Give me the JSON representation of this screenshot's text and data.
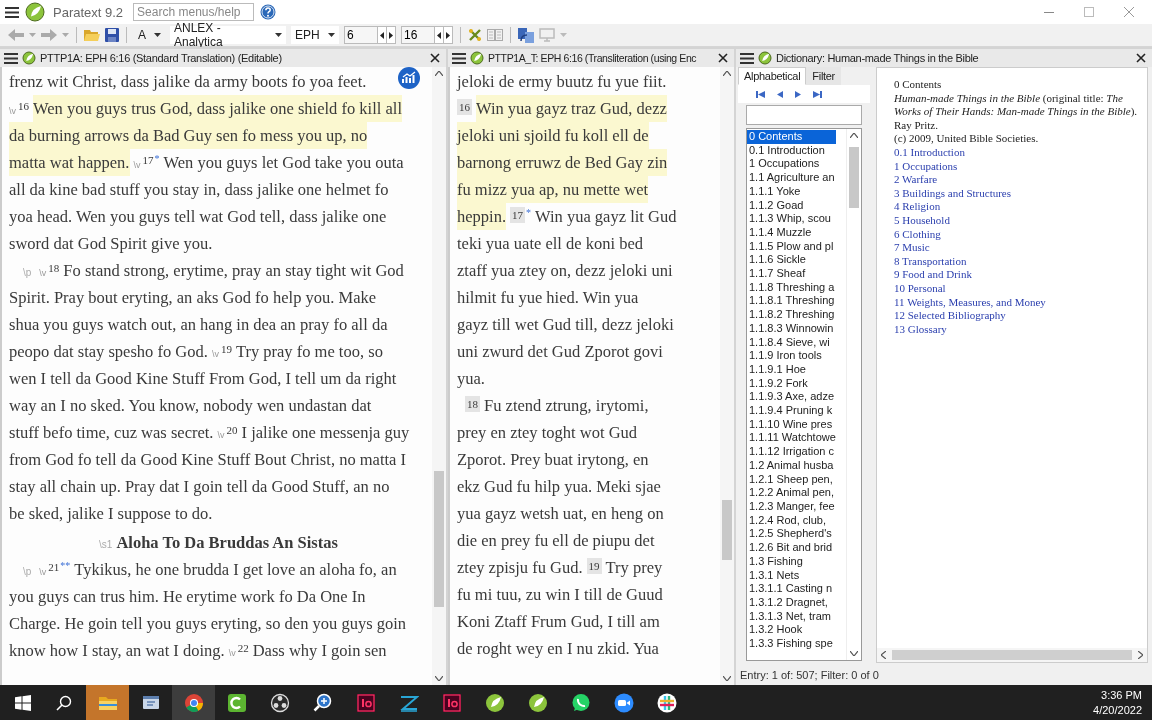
{
  "window": {
    "title": "Paratext 9.2",
    "search": {
      "placeholder": "Search menus/help"
    }
  },
  "toolbar": {
    "font": "A",
    "project": "ANLEX - Analytica",
    "book": "EPH",
    "chapter": "6",
    "verse": "16"
  },
  "panes": [
    {
      "title": "PTTP1A: EPH 6:16 (Standard Translation) (Editable)",
      "lines": [
        {
          "kind": "line",
          "segments": [
            {
              "kind": "text",
              "text": "frenz wit Christ, dass jalike da army boots fo yoa feet.",
              "highlighted": false
            }
          ]
        },
        {
          "kind": "line",
          "segments": [
            {
              "kind": "verse",
              "marker": "\\v",
              "number": "16"
            },
            {
              "kind": "text",
              "text": "Wen you guys trus God, dass jalike one shield fo kill all",
              "highlighted": true
            }
          ]
        },
        {
          "kind": "line",
          "segments": [
            {
              "kind": "text",
              "text": "da burning arrows da Bad Guy sen fo mess you up, no",
              "highlighted": true
            }
          ]
        },
        {
          "kind": "line",
          "segments": [
            {
              "kind": "text",
              "text": "matta wat happen.",
              "highlighted": true
            },
            {
              "kind": "verse",
              "marker": "\\v",
              "number": "17"
            },
            {
              "kind": "note",
              "text": "*"
            },
            {
              "kind": "text",
              "text": "Wen you guys let God take you outa",
              "highlighted": false
            }
          ]
        },
        {
          "kind": "line",
          "segments": [
            {
              "kind": "text",
              "text": "all da kine bad stuff you stay in, dass jalike one helmet fo",
              "highlighted": false
            }
          ]
        },
        {
          "kind": "line",
          "segments": [
            {
              "kind": "text",
              "text": "yoa head. Wen you guys tell wat God tell, dass jalike one",
              "highlighted": false
            }
          ]
        },
        {
          "kind": "line",
          "segments": [
            {
              "kind": "text",
              "text": "sword dat God Spirit give you.",
              "highlighted": false
            }
          ]
        },
        {
          "kind": "line",
          "marker": "\\p",
          "segments": [
            {
              "kind": "verse",
              "marker": "\\v",
              "number": "18"
            },
            {
              "kind": "text",
              "text": "Fo stand strong, erytime, pray an stay tight wit God",
              "highlighted": false
            }
          ]
        },
        {
          "kind": "line",
          "segments": [
            {
              "kind": "text",
              "text": "Spirit. Pray bout eryting, an aks God fo help you. Make",
              "highlighted": false
            }
          ]
        },
        {
          "kind": "line",
          "segments": [
            {
              "kind": "text",
              "text": "shua you guys watch out, an hang in dea an pray fo all da",
              "highlighted": false
            }
          ]
        },
        {
          "kind": "line",
          "segments": [
            {
              "kind": "text",
              "text": "peopo dat stay spesho fo God.",
              "highlighted": false
            },
            {
              "kind": "verse",
              "marker": "\\v",
              "number": "19"
            },
            {
              "kind": "text",
              "text": "Try pray fo me too, so",
              "highlighted": false
            }
          ]
        },
        {
          "kind": "line",
          "segments": [
            {
              "kind": "text",
              "text": "wen I tell da Good Kine Stuff From God, I tell um da right",
              "highlighted": false
            }
          ]
        },
        {
          "kind": "line",
          "segments": [
            {
              "kind": "text",
              "text": "way an I no sked. You know, nobody wen undastan dat",
              "highlighted": false
            }
          ]
        },
        {
          "kind": "line",
          "segments": [
            {
              "kind": "text",
              "text": "stuff befo time, cuz was secret.",
              "highlighted": false
            },
            {
              "kind": "verse",
              "marker": "\\v",
              "number": "20"
            },
            {
              "kind": "text",
              "text": "I jalike one messenja guy",
              "highlighted": false
            }
          ]
        },
        {
          "kind": "line",
          "segments": [
            {
              "kind": "text",
              "text": "from God fo tell da Good Kine Stuff Bout Christ, no matta I",
              "highlighted": false
            }
          ]
        },
        {
          "kind": "line",
          "segments": [
            {
              "kind": "text",
              "text": "stay all chain up. Pray dat I goin tell da Good Stuff, an no",
              "highlighted": false
            }
          ]
        },
        {
          "kind": "line",
          "segments": [
            {
              "kind": "text",
              "text": "be sked, jalike I suppose to do.",
              "highlighted": false
            }
          ]
        },
        {
          "kind": "heading",
          "marker": "\\s1",
          "text": "Aloha To Da Bruddas An Sistas"
        },
        {
          "kind": "line",
          "marker": "\\p",
          "segments": [
            {
              "kind": "verse",
              "marker": "\\v",
              "number": "21"
            },
            {
              "kind": "note",
              "text": "**"
            },
            {
              "kind": "text",
              "text": "Tykikus, he one brudda I get love an aloha fo, an",
              "highlighted": false
            }
          ]
        },
        {
          "kind": "line",
          "segments": [
            {
              "kind": "text",
              "text": "you guys can trus him. He erytime work fo Da One In",
              "highlighted": false
            }
          ]
        },
        {
          "kind": "line",
          "segments": [
            {
              "kind": "text",
              "text": "Charge. He goin tell you guys eryting, so den you guys goin",
              "highlighted": false
            }
          ]
        },
        {
          "kind": "line",
          "segments": [
            {
              "kind": "text",
              "text": "know how I stay, an wat I doing.",
              "highlighted": false
            },
            {
              "kind": "verse",
              "marker": "\\v",
              "number": "22"
            },
            {
              "kind": "text",
              "text": "Dass why I goin sen",
              "highlighted": false
            }
          ]
        }
      ]
    },
    {
      "title": "PTTP1A_T: EPH 6:16 (Transliteration (using Enc",
      "lines": [
        {
          "kind": "line",
          "segments": [
            {
              "kind": "text",
              "text": "jeloki de ermy buutz fu yue fiit.",
              "highlighted": false
            }
          ]
        },
        {
          "kind": "line",
          "segments": [
            {
              "kind": "verse",
              "number": "16"
            },
            {
              "kind": "text",
              "text": "Win yua gayz traz Gud, dezz",
              "highlighted": true
            }
          ]
        },
        {
          "kind": "line",
          "segments": [
            {
              "kind": "text",
              "text": "jeloki uni sjoild fu koll ell de",
              "highlighted": true
            }
          ]
        },
        {
          "kind": "line",
          "segments": [
            {
              "kind": "text",
              "text": "barnong erruwz de Bed Gay zin",
              "highlighted": true
            }
          ]
        },
        {
          "kind": "line",
          "segments": [
            {
              "kind": "text",
              "text": "fu mizz yua ap, nu mette wet",
              "highlighted": true
            }
          ]
        },
        {
          "kind": "line",
          "segments": [
            {
              "kind": "text",
              "text": "heppin.",
              "highlighted": true
            },
            {
              "kind": "verse",
              "number": "17"
            },
            {
              "kind": "note",
              "text": "*"
            },
            {
              "kind": "text",
              "text": "Win yua gayz lit Gud",
              "highlighted": false
            }
          ]
        },
        {
          "kind": "line",
          "segments": [
            {
              "kind": "text",
              "text": "teki yua uate ell de koni bed",
              "highlighted": false
            }
          ]
        },
        {
          "kind": "line",
          "segments": [
            {
              "kind": "text",
              "text": "ztaff yua ztey on, dezz jeloki uni",
              "highlighted": false
            }
          ]
        },
        {
          "kind": "line",
          "segments": [
            {
              "kind": "text",
              "text": "hilmit fu yue hied. Win yua",
              "highlighted": false
            }
          ]
        },
        {
          "kind": "line",
          "segments": [
            {
              "kind": "text",
              "text": "gayz till wet Gud till, dezz jeloki",
              "highlighted": false
            }
          ]
        },
        {
          "kind": "line",
          "segments": [
            {
              "kind": "text",
              "text": "uni zwurd det Gud Zporot govi",
              "highlighted": false
            }
          ]
        },
        {
          "kind": "line",
          "segments": [
            {
              "kind": "text",
              "text": "yua.",
              "highlighted": false
            }
          ]
        },
        {
          "kind": "line",
          "indent": true,
          "segments": [
            {
              "kind": "verse",
              "number": "18"
            },
            {
              "kind": "text",
              "text": "Fu ztend ztrung, irytomi,",
              "highlighted": false
            }
          ]
        },
        {
          "kind": "line",
          "segments": [
            {
              "kind": "text",
              "text": "prey en ztey toght wot Gud",
              "highlighted": false
            }
          ]
        },
        {
          "kind": "line",
          "segments": [
            {
              "kind": "text",
              "text": "Zporot. Prey buat irytong, en",
              "highlighted": false
            }
          ]
        },
        {
          "kind": "line",
          "segments": [
            {
              "kind": "text",
              "text": "ekz Gud fu hilp yua. Meki sjae",
              "highlighted": false
            }
          ]
        },
        {
          "kind": "line",
          "segments": [
            {
              "kind": "text",
              "text": "yua gayz wetsh uat, en heng on",
              "highlighted": false
            }
          ]
        },
        {
          "kind": "line",
          "segments": [
            {
              "kind": "text",
              "text": "die en prey fu ell de piupu det",
              "highlighted": false
            }
          ]
        },
        {
          "kind": "line",
          "segments": [
            {
              "kind": "text",
              "text": "ztey zpisju fu Gud.",
              "highlighted": false
            },
            {
              "kind": "verse",
              "number": "19"
            },
            {
              "kind": "text",
              "text": "Try prey",
              "highlighted": false
            }
          ]
        },
        {
          "kind": "line",
          "segments": [
            {
              "kind": "text",
              "text": "fu mi tuu, zu win I till de Guud",
              "highlighted": false
            }
          ]
        },
        {
          "kind": "line",
          "segments": [
            {
              "kind": "text",
              "text": "Koni Ztaff Frum Gud, I till am",
              "highlighted": false
            }
          ]
        },
        {
          "kind": "line",
          "segments": [
            {
              "kind": "text",
              "text": "de roght wey en I nu zkid. Yua",
              "highlighted": false
            }
          ]
        }
      ]
    }
  ],
  "dictionary": {
    "title": "Dictionary: Human-made Things in the Bible",
    "tabs": [
      {
        "label": "Alphabetical",
        "selected": true
      },
      {
        "label": "Filter",
        "selected": false
      }
    ],
    "entries": [
      {
        "label": "0 Contents",
        "selected": true
      },
      {
        "label": "0.1 Introduction",
        "selected": false
      },
      {
        "label": "1 Occupations",
        "selected": false
      },
      {
        "label": "1.1 Agriculture an",
        "selected": false
      },
      {
        "label": "1.1.1 Yoke",
        "selected": false
      },
      {
        "label": "1.1.2 Goad",
        "selected": false
      },
      {
        "label": "1.1.3 Whip, scou",
        "selected": false
      },
      {
        "label": "1.1.4 Muzzle",
        "selected": false
      },
      {
        "label": "1.1.5 Plow and pl",
        "selected": false
      },
      {
        "label": "1.1.6 Sickle",
        "selected": false
      },
      {
        "label": "1.1.7 Sheaf",
        "selected": false
      },
      {
        "label": "1.1.8 Threshing a",
        "selected": false
      },
      {
        "label": "1.1.8.1 Threshing",
        "selected": false
      },
      {
        "label": "1.1.8.2 Threshing",
        "selected": false
      },
      {
        "label": "1.1.8.3 Winnowin",
        "selected": false
      },
      {
        "label": "1.1.8.4 Sieve, wi",
        "selected": false
      },
      {
        "label": "1.1.9 Iron tools",
        "selected": false
      },
      {
        "label": "1.1.9.1 Hoe",
        "selected": false
      },
      {
        "label": "1.1.9.2 Fork",
        "selected": false
      },
      {
        "label": "1.1.9.3 Axe, adze",
        "selected": false
      },
      {
        "label": "1.1.9.4 Pruning k",
        "selected": false
      },
      {
        "label": "1.1.10 Wine pres",
        "selected": false
      },
      {
        "label": "1.1.11 Watchtowe",
        "selected": false
      },
      {
        "label": "1.1.12 Irrigation c",
        "selected": false
      },
      {
        "label": "1.2 Animal husba",
        "selected": false
      },
      {
        "label": "1.2.1 Sheep pen,",
        "selected": false
      },
      {
        "label": "1.2.2 Animal pen,",
        "selected": false
      },
      {
        "label": "1.2.3 Manger, fee",
        "selected": false
      },
      {
        "label": "1.2.4 Rod, club,",
        "selected": false
      },
      {
        "label": "1.2.5 Shepherd's",
        "selected": false
      },
      {
        "label": "1.2.6 Bit and brid",
        "selected": false
      },
      {
        "label": "1.3 Fishing",
        "selected": false
      },
      {
        "label": "1.3.1 Nets",
        "selected": false
      },
      {
        "label": "1.3.1.1 Casting n",
        "selected": false
      },
      {
        "label": "1.3.1.2 Dragnet,",
        "selected": false
      },
      {
        "label": "1.3.1.3 Net, tram",
        "selected": false
      },
      {
        "label": "1.3.2 Hook",
        "selected": false
      },
      {
        "label": "1.3.3 Fishing spe",
        "selected": false
      }
    ],
    "content": {
      "heading": "0 Contents",
      "citation": "*Human-made Things in the Bible* (original title: *The Works of Their Hands: Man-made Things in the Bible*). Ray Pritz.",
      "copyright": "(c) 2009, United Bible Societies.",
      "links": [
        "0.1 Introduction",
        "1 Occupations",
        "2 Warfare",
        "3 Buildings and Structures",
        "4 Religion",
        "5 Household",
        "6 Clothing",
        "7 Music",
        "8 Transportation",
        "9 Food and Drink",
        "10 Personal",
        "11 Weights, Measures, and Money",
        "12 Selected Bibliography",
        "13 Glossary"
      ]
    },
    "status": "Entry: 1 of: 507; Filter: 0 of 0"
  },
  "taskbar": {
    "apps": [
      {
        "kind": "folder",
        "flashing": true,
        "active": false
      },
      {
        "kind": "window",
        "flashing": false,
        "active": false
      },
      {
        "kind": "ring",
        "flashing": false,
        "active": true
      },
      {
        "kind": "square",
        "flashing": false,
        "active": false
      },
      {
        "kind": "aperture",
        "flashing": false,
        "active": false
      },
      {
        "kind": "magnifier",
        "flashing": false,
        "active": false
      },
      {
        "kind": "tile",
        "flashing": false,
        "active": false
      },
      {
        "kind": "zigzag",
        "flashing": false,
        "active": false
      },
      {
        "kind": "tile",
        "flashing": false,
        "active": false
      },
      {
        "kind": "leaf",
        "flashing": false,
        "active": false
      },
      {
        "kind": "leaf",
        "flashing": false,
        "active": false
      },
      {
        "kind": "chat",
        "flashing": false,
        "active": false
      },
      {
        "kind": "camera",
        "flashing": false,
        "active": false
      },
      {
        "kind": "hash",
        "flashing": false,
        "active": false
      }
    ],
    "time": "3:36 PM",
    "date": "4/20/2022"
  }
}
